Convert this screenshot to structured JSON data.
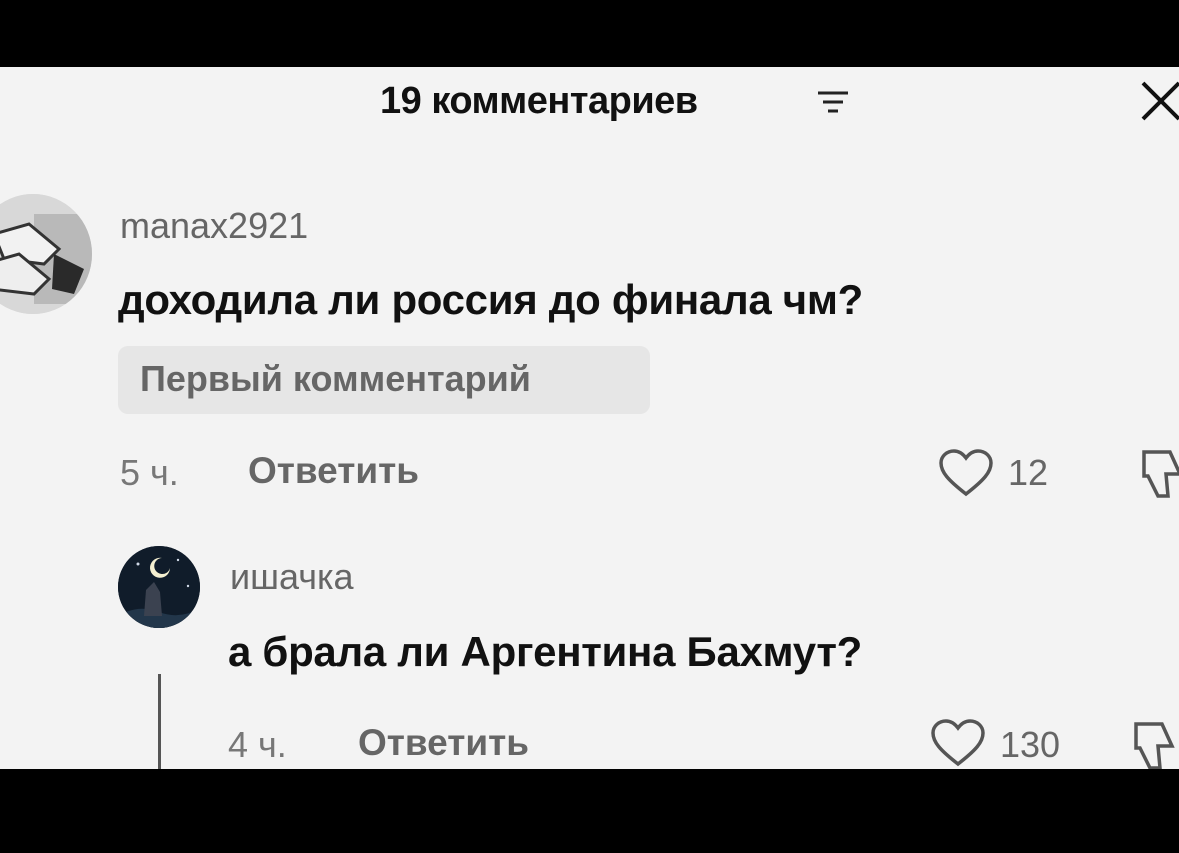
{
  "header": {
    "title": "19 комментариев",
    "filter_icon": "filter-icon",
    "close_icon": "close-icon"
  },
  "comments": [
    {
      "username": "manax2921",
      "text": "доходила ли россия до финала чм?",
      "badge": "Первый комментарий",
      "time": "5 ч.",
      "reply_label": "Ответить",
      "likes": "12"
    },
    {
      "username": "ишачка",
      "text": "а брала ли Аргентина Бахмут?",
      "time": "4 ч.",
      "reply_label": "Ответить",
      "likes": "130"
    }
  ]
}
